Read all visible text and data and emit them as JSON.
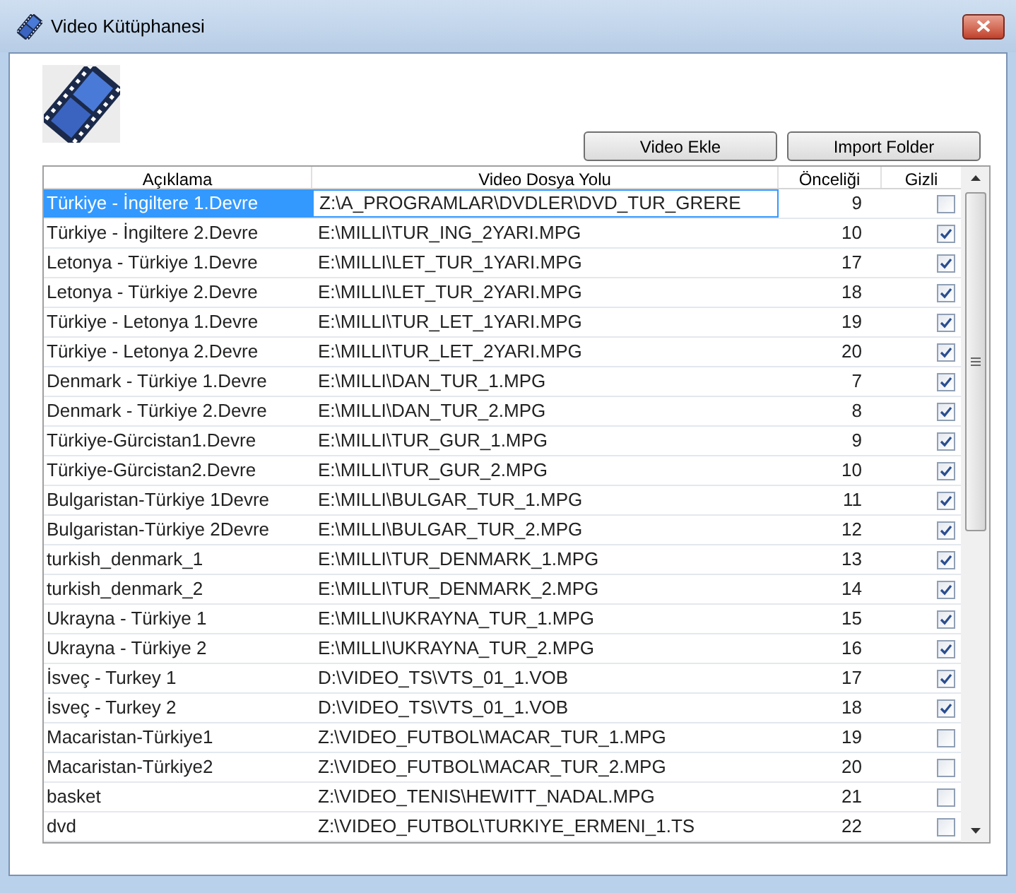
{
  "window": {
    "title": "Video Kütüphanesi"
  },
  "buttons": [
    {
      "label": "Video Ekle"
    },
    {
      "label": "Import Folder"
    }
  ],
  "table": {
    "columns": [
      "Açıklama",
      "Video Dosya Yolu",
      "Önceliği",
      "Gizli"
    ],
    "rows": [
      {
        "description": "Türkiye - İngiltere 1.Devre",
        "path": "Z:\\A_PROGRAMLAR\\DVDLER\\DVD_TUR_GRERE",
        "priority": "9",
        "hidden": false,
        "selected": true
      },
      {
        "description": "Türkiye - İngiltere 2.Devre",
        "path": "E:\\MILLI\\TUR_ING_2YARI.MPG",
        "priority": "10",
        "hidden": true,
        "selected": false
      },
      {
        "description": "Letonya - Türkiye 1.Devre",
        "path": "E:\\MILLI\\LET_TUR_1YARI.MPG",
        "priority": "17",
        "hidden": true,
        "selected": false
      },
      {
        "description": "Letonya - Türkiye 2.Devre",
        "path": "E:\\MILLI\\LET_TUR_2YARI.MPG",
        "priority": "18",
        "hidden": true,
        "selected": false
      },
      {
        "description": "Türkiye - Letonya 1.Devre",
        "path": "E:\\MILLI\\TUR_LET_1YARI.MPG",
        "priority": "19",
        "hidden": true,
        "selected": false
      },
      {
        "description": "Türkiye - Letonya 2.Devre",
        "path": "E:\\MILLI\\TUR_LET_2YARI.MPG",
        "priority": "20",
        "hidden": true,
        "selected": false
      },
      {
        "description": "Denmark - Türkiye 1.Devre",
        "path": "E:\\MILLI\\DAN_TUR_1.MPG",
        "priority": "7",
        "hidden": true,
        "selected": false
      },
      {
        "description": "Denmark - Türkiye 2.Devre",
        "path": "E:\\MILLI\\DAN_TUR_2.MPG",
        "priority": "8",
        "hidden": true,
        "selected": false
      },
      {
        "description": "Türkiye-Gürcistan1.Devre",
        "path": "E:\\MILLI\\TUR_GUR_1.MPG",
        "priority": "9",
        "hidden": true,
        "selected": false
      },
      {
        "description": "Türkiye-Gürcistan2.Devre",
        "path": "E:\\MILLI\\TUR_GUR_2.MPG",
        "priority": "10",
        "hidden": true,
        "selected": false
      },
      {
        "description": "Bulgaristan-Türkiye 1Devre",
        "path": "E:\\MILLI\\BULGAR_TUR_1.MPG",
        "priority": "11",
        "hidden": true,
        "selected": false
      },
      {
        "description": "Bulgaristan-Türkiye 2Devre",
        "path": "E:\\MILLI\\BULGAR_TUR_2.MPG",
        "priority": "12",
        "hidden": true,
        "selected": false
      },
      {
        "description": "turkish_denmark_1",
        "path": "E:\\MILLI\\TUR_DENMARK_1.MPG",
        "priority": "13",
        "hidden": true,
        "selected": false
      },
      {
        "description": "turkish_denmark_2",
        "path": "E:\\MILLI\\TUR_DENMARK_2.MPG",
        "priority": "14",
        "hidden": true,
        "selected": false
      },
      {
        "description": "Ukrayna - Türkiye 1",
        "path": "E:\\MILLI\\UKRAYNA_TUR_1.MPG",
        "priority": "15",
        "hidden": true,
        "selected": false
      },
      {
        "description": "Ukrayna - Türkiye 2",
        "path": "E:\\MILLI\\UKRAYNA_TUR_2.MPG",
        "priority": "16",
        "hidden": true,
        "selected": false
      },
      {
        "description": "İsveç - Turkey 1",
        "path": "D:\\VIDEO_TS\\VTS_01_1.VOB",
        "priority": "17",
        "hidden": true,
        "selected": false
      },
      {
        "description": "İsveç - Turkey 2",
        "path": "D:\\VIDEO_TS\\VTS_01_1.VOB",
        "priority": "18",
        "hidden": true,
        "selected": false
      },
      {
        "description": "Macaristan-Türkiye1",
        "path": "Z:\\VIDEO_FUTBOL\\MACAR_TUR_1.MPG",
        "priority": "19",
        "hidden": false,
        "selected": false
      },
      {
        "description": "Macaristan-Türkiye2",
        "path": "Z:\\VIDEO_FUTBOL\\MACAR_TUR_2.MPG",
        "priority": "20",
        "hidden": false,
        "selected": false
      },
      {
        "description": "basket",
        "path": "Z:\\VIDEO_TENIS\\HEWITT_NADAL.MPG",
        "priority": "21",
        "hidden": false,
        "selected": false
      },
      {
        "description": "dvd",
        "path": "Z:\\VIDEO_FUTBOL\\TURKIYE_ERMENI_1.TS",
        "priority": "22",
        "hidden": false,
        "selected": false
      }
    ]
  }
}
